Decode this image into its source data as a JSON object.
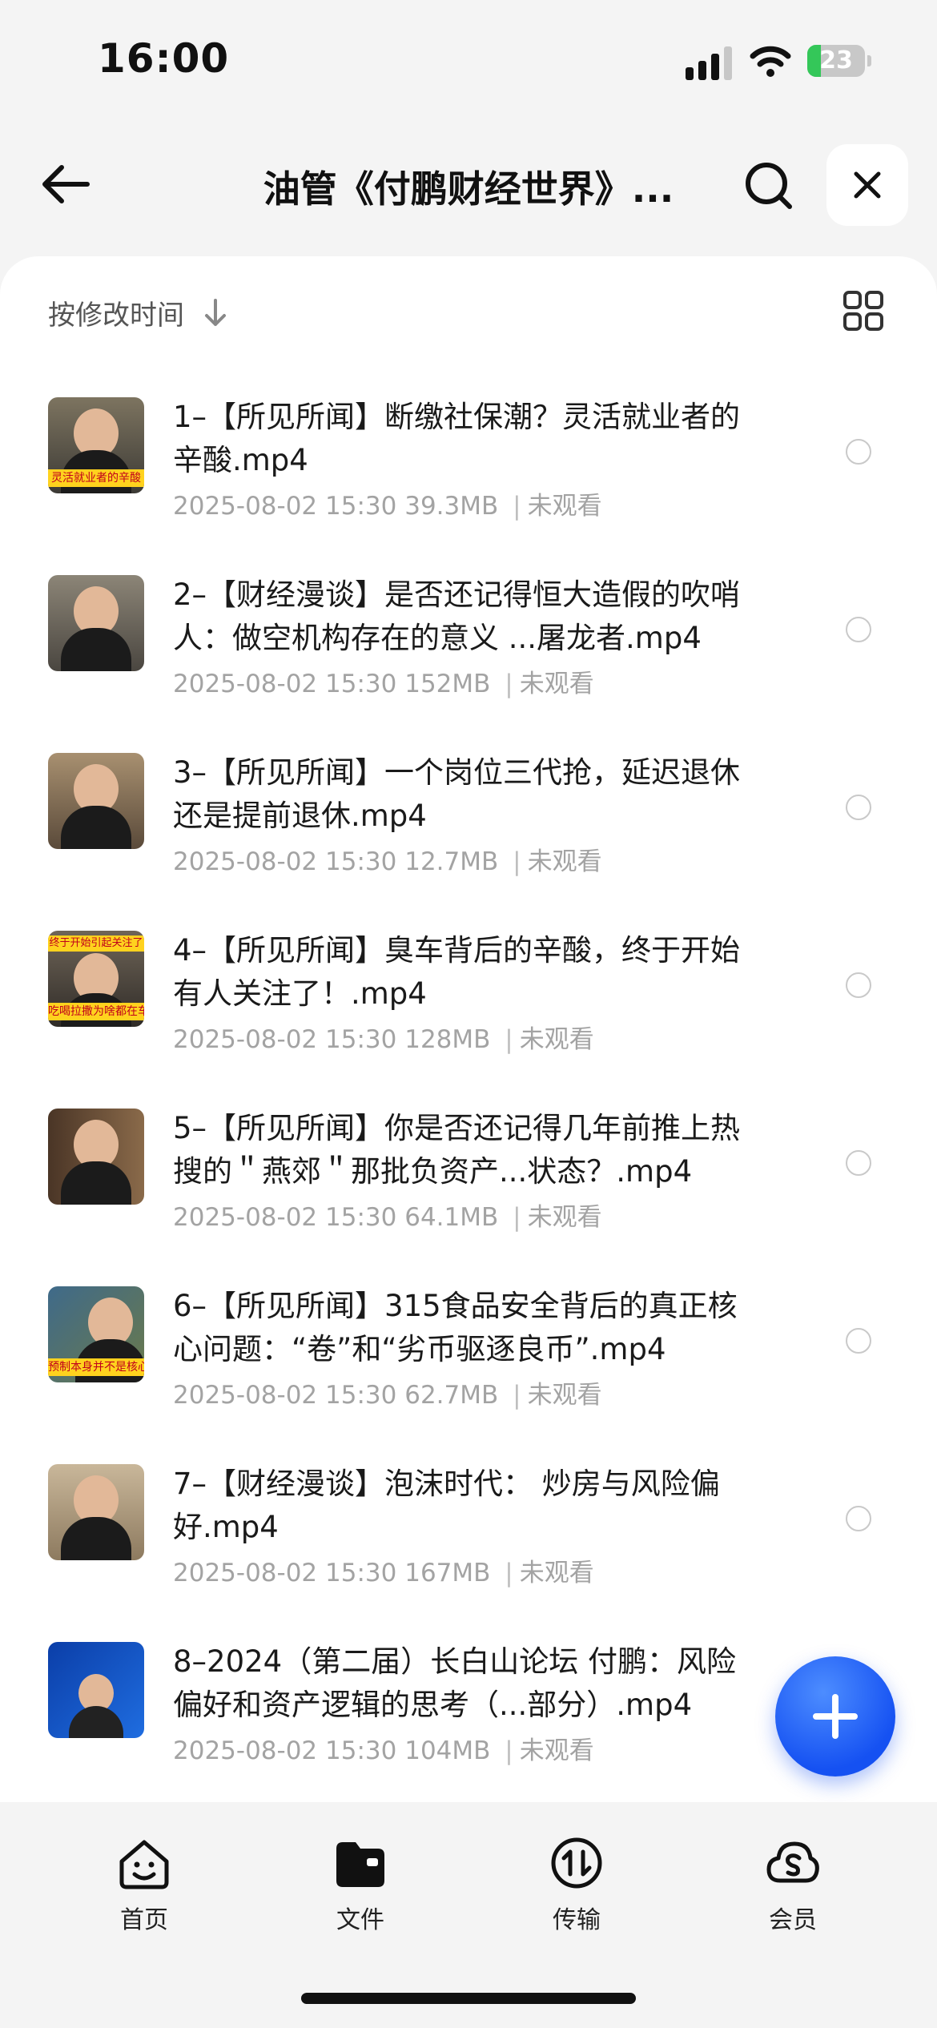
{
  "status_bar": {
    "time": "16:00",
    "battery": "23",
    "battery_percent": 23
  },
  "header": {
    "title": "油管《付鹏财经世界》...",
    "back_icon": "arrow-left-icon",
    "search_icon": "search-icon",
    "close_icon": "close-icon"
  },
  "toolbar": {
    "sort_label": "按修改时间",
    "sort_icon": "arrow-down-icon",
    "view_icon": "grid-view-icon"
  },
  "files": [
    {
      "name": "1–【所见所闻】断缴社保潮？灵活就业者的辛酸.mp4",
      "date": "2025-08-02 15:30",
      "size": "39.3MB",
      "status": "未观看",
      "thumb_caption": "灵活就业者的辛酸",
      "thumb_top": ""
    },
    {
      "name": "2–【财经漫谈】是否还记得恒大造假的吹哨人：做空机构存在的意义 ...屠龙者.mp4",
      "date": "2025-08-02 15:30",
      "size": "152MB",
      "status": "未观看",
      "thumb_caption": "",
      "thumb_top": ""
    },
    {
      "name": "3–【所见所闻】一个岗位三代抢，延迟退休还是提前退休.mp4",
      "date": "2025-08-02 15:30",
      "size": "12.7MB",
      "status": "未观看",
      "thumb_caption": "",
      "thumb_top": ""
    },
    {
      "name": "4–【所见所闻】臭车背后的辛酸，终于开始有人关注了！.mp4",
      "date": "2025-08-02 15:30",
      "size": "128MB",
      "status": "未观看",
      "thumb_caption": "吃喝拉撒为啥都在车里",
      "thumb_top": "终于开始引起关注了"
    },
    {
      "name": "5–【所见所闻】你是否还记得几年前推上热搜的＂燕郊＂那批负资产...状态？.mp4",
      "date": "2025-08-02 15:30",
      "size": "64.1MB",
      "status": "未观看",
      "thumb_caption": "",
      "thumb_top": ""
    },
    {
      "name": "6–【所见所闻】315食品安全背后的真正核心问题：“卷”和“劣币驱逐良币”.mp4",
      "date": "2025-08-02 15:30",
      "size": "62.7MB",
      "status": "未观看",
      "thumb_caption": "预制本身并不是核心问题",
      "thumb_top": ""
    },
    {
      "name": "7–【财经漫谈】泡沫时代： 炒房与风险偏好.mp4",
      "date": "2025-08-02 15:30",
      "size": "167MB",
      "status": "未观看",
      "thumb_caption": "",
      "thumb_top": ""
    },
    {
      "name": "8–2024（第二届）长白山论坛 付鹏：风险偏好和资产逻辑的思考（...部分）.mp4",
      "date": "2025-08-02 15:30",
      "size": "104MB",
      "status": "未观看",
      "thumb_caption": "",
      "thumb_top": ""
    }
  ],
  "fab": {
    "icon": "plus-icon"
  },
  "tabs": [
    {
      "label": "首页",
      "icon": "home-smile-icon"
    },
    {
      "label": "文件",
      "icon": "folder-icon"
    },
    {
      "label": "传输",
      "icon": "transfer-icon"
    },
    {
      "label": "会员",
      "icon": "cloud-member-icon"
    }
  ],
  "colors": {
    "accent": "#1551f2",
    "background": "#f4f4f4",
    "panel": "#ffffff",
    "meta_text": "#a3a3a3",
    "battery_green": "#34c759"
  }
}
